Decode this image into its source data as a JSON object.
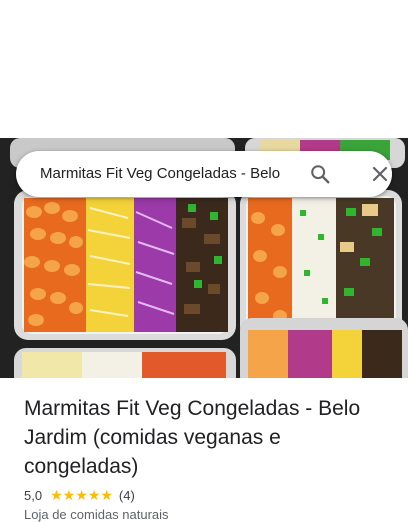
{
  "search": {
    "query": "Marmitas Fit Veg Congeladas - Belo"
  },
  "place": {
    "name": "Marmitas Fit Veg Congeladas - Belo Jardim (comidas veganas e congeladas)",
    "rating": "5,0",
    "stars": 5,
    "review_count": "(4)",
    "category": "Loja de comidas naturais"
  },
  "icons": {
    "search": "search-icon",
    "close": "close-icon",
    "star": "star-icon"
  },
  "colors": {
    "star": "#fbbc04",
    "icon": "#5f6368",
    "text": "#202124"
  }
}
